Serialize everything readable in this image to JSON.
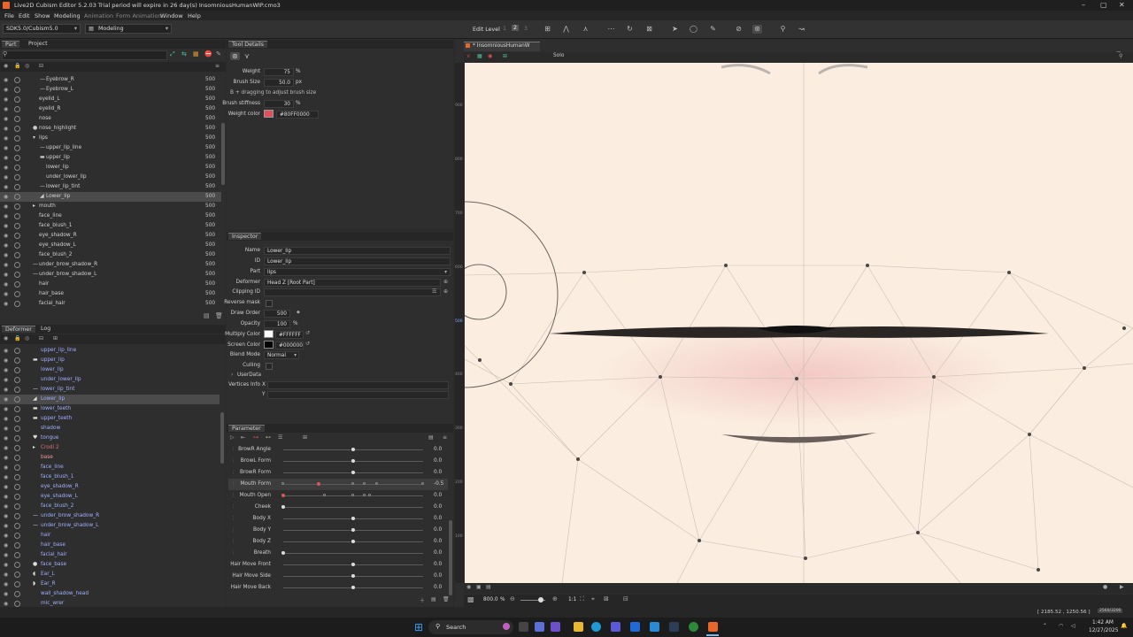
{
  "app": {
    "title": "Live2D Cubism Editor 5.2.03    Trial period will expire in 26 day(s)    InsomniousHumanWIP.cmo3"
  },
  "menu": [
    {
      "label": "File",
      "enabled": true
    },
    {
      "label": "Edit",
      "enabled": true
    },
    {
      "label": "Show",
      "enabled": true
    },
    {
      "label": "Modeling",
      "enabled": true
    },
    {
      "label": "Animation",
      "enabled": false
    },
    {
      "label": "Form Animation",
      "enabled": false
    },
    {
      "label": "Window",
      "enabled": true
    },
    {
      "label": "Help",
      "enabled": true
    }
  ],
  "toolbar": {
    "sdk": "SDK5.0/Cubism5.0",
    "mode": "Modeling",
    "edit_level_label": "Edit Level",
    "edit_levels": [
      "1",
      "2",
      "3"
    ]
  },
  "part_panel": {
    "tabs": [
      "Part",
      "Project"
    ],
    "rows": [
      {
        "name": "Eyebrow_R",
        "value": "500",
        "indent": 2,
        "glyph": "—"
      },
      {
        "name": "Eyebrow_L",
        "value": "500",
        "indent": 2,
        "glyph": "—"
      },
      {
        "name": "eyelid_L",
        "value": "500",
        "indent": 1,
        "glyph": ""
      },
      {
        "name": "eyelid_R",
        "value": "500",
        "indent": 1,
        "glyph": ""
      },
      {
        "name": "nose",
        "value": "500",
        "indent": 1,
        "glyph": ""
      },
      {
        "name": "nose_highlight",
        "value": "500",
        "indent": 1,
        "glyph": "●"
      },
      {
        "name": "lips",
        "value": "500",
        "indent": 1,
        "glyph": "▾"
      },
      {
        "name": "upper_lip_line",
        "value": "500",
        "indent": 2,
        "glyph": "—"
      },
      {
        "name": "upper_lip",
        "value": "500",
        "indent": 2,
        "glyph": "▬"
      },
      {
        "name": "lower_lip",
        "value": "500",
        "indent": 2,
        "glyph": ""
      },
      {
        "name": "under_lower_lip",
        "value": "500",
        "indent": 2,
        "glyph": ""
      },
      {
        "name": "lower_lip_tint",
        "value": "500",
        "indent": 2,
        "glyph": "—"
      },
      {
        "name": "Lower_lip",
        "value": "500",
        "indent": 2,
        "glyph": "◢",
        "selected": true
      },
      {
        "name": "mouth",
        "value": "500",
        "indent": 1,
        "glyph": "▸"
      },
      {
        "name": "face_line",
        "value": "500",
        "indent": 1,
        "glyph": ""
      },
      {
        "name": "face_blush_1",
        "value": "500",
        "indent": 1,
        "glyph": ""
      },
      {
        "name": "eye_shadow_R",
        "value": "500",
        "indent": 1,
        "glyph": ""
      },
      {
        "name": "eye_shadow_L",
        "value": "500",
        "indent": 1,
        "glyph": ""
      },
      {
        "name": "face_blush_2",
        "value": "500",
        "indent": 1,
        "glyph": ""
      },
      {
        "name": "under_brow_shadow_R",
        "value": "500",
        "indent": 1,
        "glyph": "—"
      },
      {
        "name": "under_brow_shadow_L",
        "value": "500",
        "indent": 1,
        "glyph": "—"
      },
      {
        "name": "hair",
        "value": "500",
        "indent": 1,
        "glyph": ""
      },
      {
        "name": "hair_base",
        "value": "500",
        "indent": 1,
        "glyph": ""
      },
      {
        "name": "facial_hair",
        "value": "500",
        "indent": 1,
        "glyph": ""
      }
    ]
  },
  "deformer_panel": {
    "tabs": [
      "Deformer",
      "Log"
    ],
    "rows": [
      {
        "name": "upper_lip_line",
        "kind": "art",
        "glyph": ""
      },
      {
        "name": "upper_lip",
        "kind": "art",
        "glyph": "▬"
      },
      {
        "name": "lower_lip",
        "kind": "art",
        "glyph": ""
      },
      {
        "name": "under_lower_lip",
        "kind": "art",
        "glyph": ""
      },
      {
        "name": "lower_lip_tint",
        "kind": "art",
        "glyph": "—"
      },
      {
        "name": "Lower_lip",
        "kind": "art",
        "glyph": "◢",
        "selected": true
      },
      {
        "name": "lower_teeth",
        "kind": "art",
        "glyph": "▬"
      },
      {
        "name": "upper_teeth",
        "kind": "art",
        "glyph": "▬"
      },
      {
        "name": "shadow",
        "kind": "art",
        "glyph": ""
      },
      {
        "name": "tongue",
        "kind": "art",
        "glyph": "♥"
      },
      {
        "name": "Crodi 2",
        "kind": "rot",
        "glyph": "▸"
      },
      {
        "name": "base",
        "kind": "warp",
        "glyph": ""
      },
      {
        "name": "face_line",
        "kind": "art",
        "glyph": ""
      },
      {
        "name": "face_blush_1",
        "kind": "art",
        "glyph": ""
      },
      {
        "name": "eye_shadow_R",
        "kind": "art",
        "glyph": ""
      },
      {
        "name": "eye_shadow_L",
        "kind": "art",
        "glyph": ""
      },
      {
        "name": "face_blush_2",
        "kind": "art",
        "glyph": ""
      },
      {
        "name": "under_brow_shadow_R",
        "kind": "art",
        "glyph": "—"
      },
      {
        "name": "under_brow_shadow_L",
        "kind": "art",
        "glyph": "—"
      },
      {
        "name": "hair",
        "kind": "art",
        "glyph": ""
      },
      {
        "name": "hair_base",
        "kind": "art",
        "glyph": ""
      },
      {
        "name": "facial_hair",
        "kind": "art",
        "glyph": ""
      },
      {
        "name": "face_base",
        "kind": "art",
        "glyph": "●"
      },
      {
        "name": "Ear_L",
        "kind": "art",
        "glyph": "◖"
      },
      {
        "name": "Ear_R",
        "kind": "art",
        "glyph": "◗"
      },
      {
        "name": "wall_shadow_head",
        "kind": "art",
        "glyph": ""
      },
      {
        "name": "mic_wrer",
        "kind": "art",
        "glyph": ""
      }
    ]
  },
  "tool_details": {
    "title": "Tool Details",
    "weight_label": "Weight",
    "weight_value": "75",
    "weight_unit": "%",
    "brush_size_label": "Brush Size",
    "brush_size_value": "50.0",
    "brush_size_unit": "px",
    "hint": "B + dragging to adjust brush size",
    "stiffness_label": "Brush stiffness",
    "stiffness_value": "30",
    "stiffness_unit": "%",
    "weight_color_label": "Weight color",
    "weight_color_value": "#80FF0000",
    "weight_color_swatch": "#e0505a"
  },
  "inspector": {
    "title": "Inspector",
    "name_label": "Name",
    "name_value": "Lower_lip",
    "id_label": "ID",
    "id_value": "Lower_lip",
    "part_label": "Part",
    "part_value": "lips",
    "deformer_label": "Deformer",
    "deformer_value": "Head Z  [Root Part]",
    "clipping_label": "Clipping ID",
    "clipping_value": "",
    "reverse_mask_label": "Reverse mask",
    "draw_order_label": "Draw Order",
    "draw_order_value": "500",
    "opacity_label": "Opacity",
    "opacity_value": "100",
    "opacity_unit": "%",
    "multiply_label": "Multiply Color",
    "multiply_value": "#FFFFFF",
    "screen_label": "Screen Color",
    "screen_value": "#000000",
    "blend_label": "Blend Mode",
    "blend_value": "Normal",
    "culling_label": "Culling",
    "userdata_label": "UserData",
    "vertices_label": "Vertices Info",
    "x_label": "X",
    "y_label": "Y"
  },
  "parameter": {
    "title": "Parameter",
    "rows": [
      {
        "label": "BrowR Angle",
        "value": "0.0",
        "knob": 0.5,
        "points": [
          0.5
        ]
      },
      {
        "label": "BrowL Form",
        "value": "0.0",
        "knob": 0.5,
        "points": [
          0.5
        ]
      },
      {
        "label": "BrowR Form",
        "value": "0.0",
        "knob": 0.5,
        "points": [
          0.5
        ]
      },
      {
        "label": "Mouth Form",
        "value": "-0.5",
        "knob": 0.25,
        "points": [
          0.0,
          0.25,
          0.5,
          0.58,
          0.67,
          1.0
        ],
        "selected": true,
        "accent": true
      },
      {
        "label": "Mouth Open",
        "value": "0.0",
        "knob": 0.0,
        "points": [
          0.0,
          0.3,
          0.5,
          0.58,
          0.62
        ],
        "accent": true
      },
      {
        "label": "Cheek",
        "value": "0.0",
        "knob": 0.0,
        "points": [
          0.0
        ]
      },
      {
        "label": "Body X",
        "value": "0.0",
        "knob": 0.5,
        "points": [
          0.5
        ]
      },
      {
        "label": "Body Y",
        "value": "0.0",
        "knob": 0.5,
        "points": [
          0.5
        ]
      },
      {
        "label": "Body Z",
        "value": "0.0",
        "knob": 0.5,
        "points": [
          0.5
        ]
      },
      {
        "label": "Breath",
        "value": "0.0",
        "knob": 0.0,
        "points": [
          0.0
        ]
      },
      {
        "label": "Hair Move Front",
        "value": "0.0",
        "knob": 0.5,
        "points": [
          0.5
        ]
      },
      {
        "label": "Hair Move Side",
        "value": "0.0",
        "knob": 0.5,
        "points": [
          0.5
        ]
      },
      {
        "label": "Hair Move Back",
        "value": "0.0",
        "knob": 0.5,
        "points": [
          0.5
        ]
      }
    ]
  },
  "viewport": {
    "tab_label": "* InsomniousHumanW",
    "solo_label": "Solo",
    "zoom": "800.0",
    "zoom_unit": "%",
    "ratio": "1:1",
    "ruler_labels": [
      "900",
      "800",
      "700",
      "600",
      "500",
      "400",
      "300",
      "200",
      "100"
    ],
    "coords": "[ 2185.52 , 1250.56 ]",
    "zoom_badge": "2560/3200"
  },
  "taskbar": {
    "search": "Search",
    "time": "1:42 AM",
    "date": "12/27/2025"
  },
  "colors": {
    "canvas": "#fbeee1",
    "accent": "#e0505a",
    "selection": "#4b4b4b"
  }
}
